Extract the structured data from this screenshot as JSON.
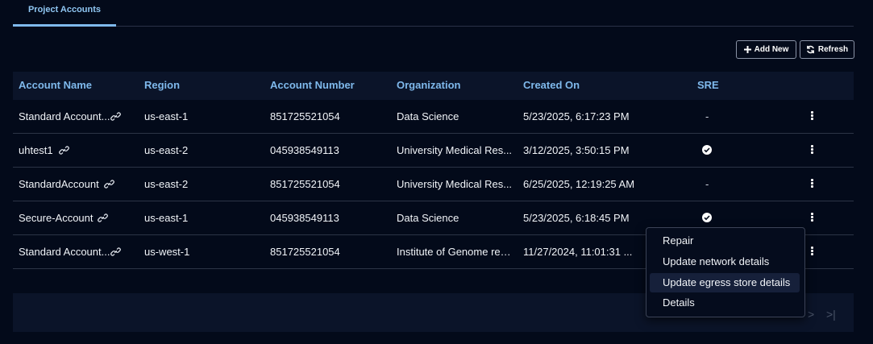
{
  "tabs": [
    {
      "label": "Project Accounts",
      "active": true
    }
  ],
  "toolbar": {
    "add_label": "Add New",
    "refresh_label": "Refresh"
  },
  "table": {
    "headers": [
      "Account Name",
      "Region",
      "Account Number",
      "Organization",
      "Created On",
      "SRE"
    ],
    "rows": [
      {
        "name": "Standard Account...",
        "region": "us-east-1",
        "number": "851725521054",
        "org": "Data Science",
        "created": "5/23/2025, 6:17:23 PM",
        "sre": "-"
      },
      {
        "name": "uhtest1",
        "region": "us-east-2",
        "number": "045938549113",
        "org": "University Medical Res...",
        "created": "3/12/2025, 3:50:15 PM",
        "sre": "check"
      },
      {
        "name": "StandardAccount",
        "region": "us-east-2",
        "number": "851725521054",
        "org": "University Medical Res...",
        "created": "6/25/2025, 12:19:25 AM",
        "sre": "-"
      },
      {
        "name": "Secure-Account",
        "region": "us-east-1",
        "number": "045938549113",
        "org": "Data Science",
        "created": "5/23/2025, 6:18:45 PM",
        "sre": "check"
      },
      {
        "name": "Standard Account...",
        "region": "us-west-1",
        "number": "851725521054",
        "org": "Institute of Genome res...",
        "created": "11/27/2024, 11:01:31 ...",
        "sre": ""
      }
    ]
  },
  "context_menu": {
    "items": [
      {
        "label": "Repair"
      },
      {
        "label": "Update network details"
      },
      {
        "label": "Update egress store details"
      },
      {
        "label": "Details"
      }
    ]
  },
  "pagination": {
    "next": ">",
    "last": ">|"
  },
  "colors": {
    "accent": "#7fb9ec",
    "background": "#030a1a",
    "header_bg": "#0b1429"
  }
}
